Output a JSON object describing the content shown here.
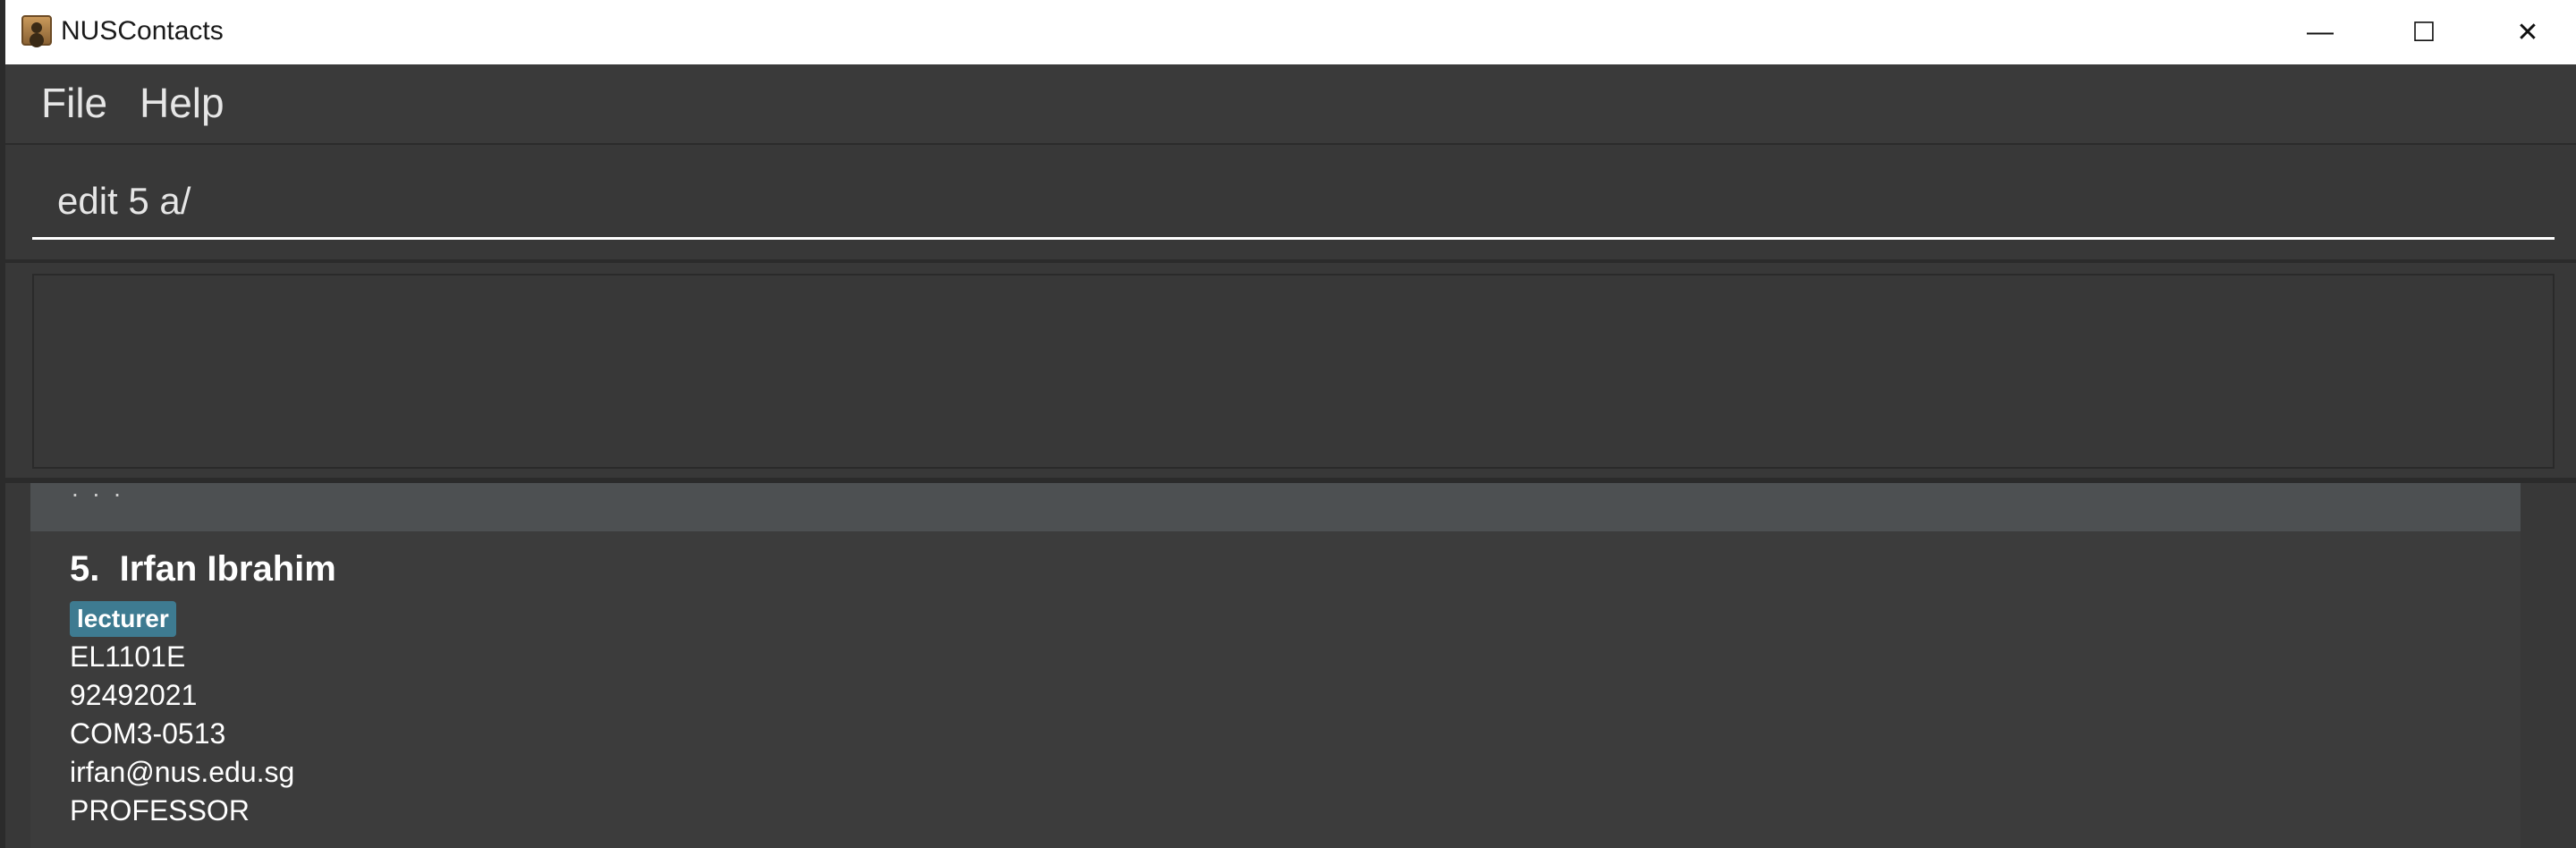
{
  "window": {
    "title": "NUSContacts",
    "controls": {
      "minimize": "—",
      "maximize": "☐",
      "close": "✕"
    }
  },
  "menu": {
    "items": [
      "File",
      "Help"
    ]
  },
  "command": {
    "value": "edit 5 a/"
  },
  "result": {
    "text": ""
  },
  "list": {
    "previous_fragment": ". . .",
    "person": {
      "index": "5.",
      "name": "Irfan Ibrahim",
      "tags": [
        "lecturer"
      ],
      "module": "EL1101E",
      "phone": "92492021",
      "office": "COM3-0513",
      "email": "irfan@nus.edu.sg",
      "designation": "PROFESSOR"
    }
  },
  "colors": {
    "background": "#383838",
    "card": "#3c3c3c",
    "card_selected_prev": "#4d5052",
    "tag": "#3e7b91",
    "titlebar": "#ffffff"
  }
}
